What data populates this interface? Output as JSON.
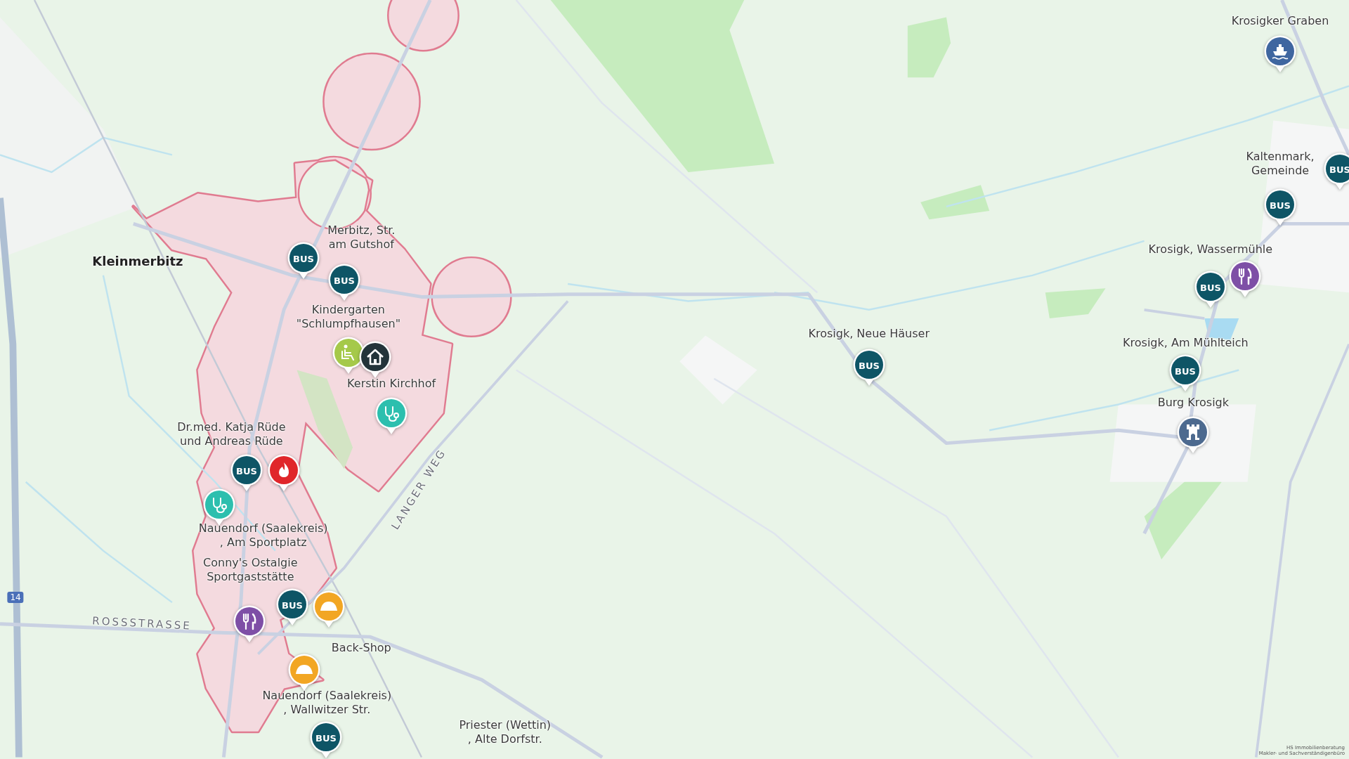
{
  "map": {
    "labels": [
      {
        "kind": "place",
        "text": "Kleinmerbitz"
      },
      {
        "kind": "poi",
        "text": "Merbitz, Str.\nam Gutshof"
      },
      {
        "kind": "poi",
        "text": "Kindergarten\n\"Schlumpfhausen\""
      },
      {
        "kind": "poi",
        "text": "Kerstin Kirchhof"
      },
      {
        "kind": "poi",
        "text": "Dr.med. Katja Rüde\nund Andreas Rüde"
      },
      {
        "kind": "poi",
        "text": "Nauendorf (Saalekreis)\n, Am Sportplatz"
      },
      {
        "kind": "poi",
        "text": "Conny's Ostalgie\nSportgaststätte"
      },
      {
        "kind": "poi",
        "text": "Back-Shop"
      },
      {
        "kind": "poi",
        "text": "Nauendorf (Saalekreis)\n, Wallwitzer Str."
      },
      {
        "kind": "poi",
        "text": "Priester (Wettin)\n, Alte Dorfstr."
      },
      {
        "kind": "poi",
        "text": "Krosigk, Neue Häuser"
      },
      {
        "kind": "poi",
        "text": "Krosigker Graben"
      },
      {
        "kind": "poi",
        "text": "Kaltenmark,\nGemeinde"
      },
      {
        "kind": "poi",
        "text": "Krosigk, Wassermühle"
      },
      {
        "kind": "poi",
        "text": "Krosigk, Am Mühlteich"
      },
      {
        "kind": "poi",
        "text": "Burg Krosigk"
      },
      {
        "kind": "street",
        "text": "LANGER WEG"
      },
      {
        "kind": "street",
        "text": "ROSSSTRASSE"
      },
      {
        "kind": "road_number",
        "text": "14"
      }
    ],
    "markers": [
      {
        "kind": "bus",
        "color": "#0e5566",
        "label": "BUS"
      },
      {
        "kind": "bus",
        "color": "#0e5566",
        "label": "BUS"
      },
      {
        "kind": "fitness",
        "color": "#a5c94a"
      },
      {
        "kind": "home",
        "color": "#23343a"
      },
      {
        "kind": "doctor",
        "color": "#2cbfae"
      },
      {
        "kind": "bus",
        "color": "#0e5566",
        "label": "BUS"
      },
      {
        "kind": "fire",
        "color": "#e0262a"
      },
      {
        "kind": "doctor",
        "color": "#2cbfae"
      },
      {
        "kind": "bus",
        "color": "#0e5566",
        "label": "BUS"
      },
      {
        "kind": "bakery",
        "color": "#f2a623"
      },
      {
        "kind": "restaurant",
        "color": "#7e4fa6"
      },
      {
        "kind": "bakery",
        "color": "#f2a623"
      },
      {
        "kind": "bus",
        "color": "#0e5566",
        "label": "BUS"
      },
      {
        "kind": "bus",
        "color": "#0e5566",
        "label": "BUS"
      },
      {
        "kind": "boat",
        "color": "#3f66a0"
      },
      {
        "kind": "bus",
        "color": "#0e5566",
        "label": "BUS"
      },
      {
        "kind": "bus",
        "color": "#0e5566",
        "label": "BUS"
      },
      {
        "kind": "bus",
        "color": "#0e5566",
        "label": "BUS"
      },
      {
        "kind": "restaurant",
        "color": "#7e4fa6"
      },
      {
        "kind": "bus",
        "color": "#0e5566",
        "label": "BUS"
      },
      {
        "kind": "castle",
        "color": "#4d6a8f"
      }
    ],
    "attribution": [
      "HS Immobilienberatung",
      "Makler- und Sachverständigenbüro"
    ]
  }
}
